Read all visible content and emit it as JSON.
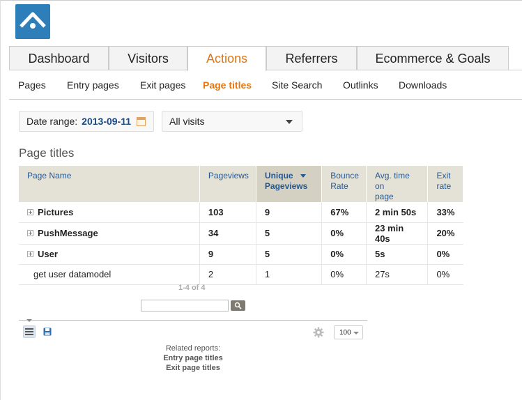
{
  "tabs": [
    {
      "label": "Dashboard"
    },
    {
      "label": "Visitors"
    },
    {
      "label": "Actions"
    },
    {
      "label": "Referrers"
    },
    {
      "label": "Ecommerce & Goals"
    }
  ],
  "active_tab": "Actions",
  "subnav": [
    {
      "label": "Pages"
    },
    {
      "label": "Entry pages"
    },
    {
      "label": "Exit pages"
    },
    {
      "label": "Page titles"
    },
    {
      "label": "Site Search"
    },
    {
      "label": "Outlinks"
    },
    {
      "label": "Downloads"
    }
  ],
  "active_subnav": "Page titles",
  "controls": {
    "date_label": "Date range:",
    "date_value": "2013-09-11",
    "segment": "All visits"
  },
  "report": {
    "title": "Page titles",
    "columns": [
      "Page Name",
      "Pageviews",
      "Unique Pageviews",
      "Bounce Rate",
      "Avg. time on page",
      "Exit rate"
    ],
    "column_lines": [
      [
        "Page Name"
      ],
      [
        "Pageviews"
      ],
      [
        "Unique",
        "Pageviews"
      ],
      [
        "Bounce",
        "Rate"
      ],
      [
        "Avg. time on",
        "page"
      ],
      [
        "Exit",
        "rate"
      ]
    ],
    "sorted_column": "Unique Pageviews",
    "rows": [
      {
        "name": "Pictures",
        "pageviews": "103",
        "unique": "9",
        "bounce": "67%",
        "avg_time": "2 min 50s",
        "exit": "33%",
        "expandable": true
      },
      {
        "name": "PushMessage",
        "pageviews": "34",
        "unique": "5",
        "bounce": "0%",
        "avg_time": "23 min 40s",
        "exit": "20%",
        "expandable": true
      },
      {
        "name": "User",
        "pageviews": "9",
        "unique": "5",
        "bounce": "0%",
        "avg_time": "5s",
        "exit": "0%",
        "expandable": true
      },
      {
        "name": "get user datamodel",
        "pageviews": "2",
        "unique": "1",
        "bounce": "0%",
        "avg_time": "27s",
        "exit": "0%",
        "expandable": false
      }
    ],
    "pagination": "1-4 of 4",
    "limit": "100"
  },
  "related": {
    "label": "Related reports:",
    "links": [
      "Entry page titles",
      "Exit page titles"
    ]
  },
  "icons": {
    "logo": "piwik-logo",
    "calendar": "calendar-icon",
    "search": "magnifier-icon",
    "table_view": "table-view-icon",
    "export": "floppy-disk-icon",
    "settings": "gear-icon"
  },
  "colors": {
    "accent": "#e27714",
    "link_blue": "#255792",
    "header_bg": "#e4e2d7"
  }
}
